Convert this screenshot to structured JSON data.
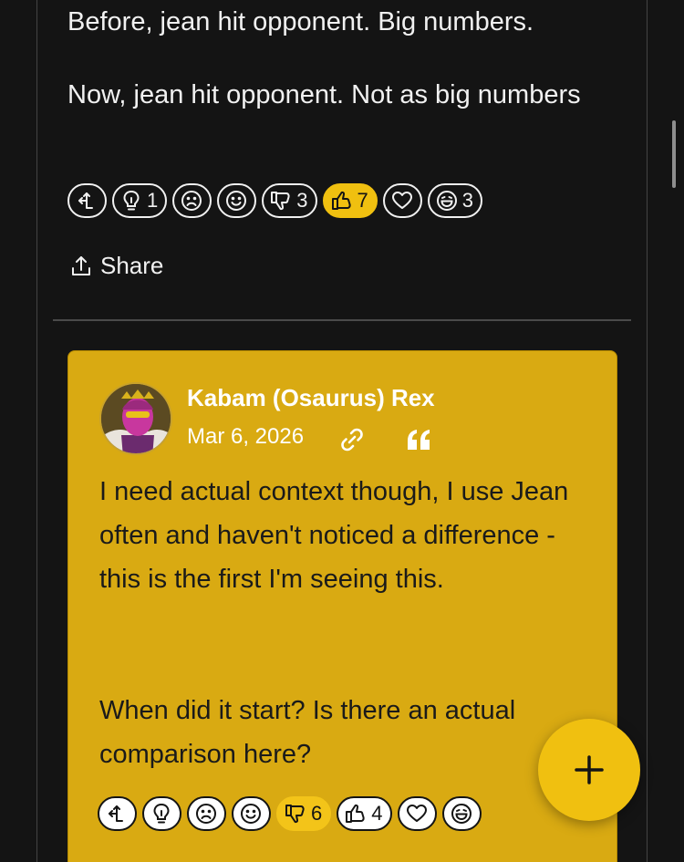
{
  "post": {
    "paragraph_1": "Before, jean hit opponent. Big numbers.",
    "paragraph_2": "Now, jean hit opponent. Not as big numbers",
    "reactions": [
      {
        "icon": "insightful-icon",
        "count": ""
      },
      {
        "icon": "lightbulb-icon",
        "count": "1"
      },
      {
        "icon": "sad-icon",
        "count": ""
      },
      {
        "icon": "smile-icon",
        "count": ""
      },
      {
        "icon": "thumbs-down-icon",
        "count": "3"
      },
      {
        "icon": "thumbs-up-icon",
        "count": "7"
      },
      {
        "icon": "heart-icon",
        "count": ""
      },
      {
        "icon": "laugh-icon",
        "count": "3"
      }
    ],
    "share_label": "Share"
  },
  "reply": {
    "author": "Kabam (Osaurus) Rex",
    "date": "Mar 6, 2026",
    "paragraph_1": "I need actual context though, I use Jean often and haven't noticed a difference - this is the first I'm seeing this.",
    "paragraph_2": "When did it start? Is there an actual comparison here?",
    "reactions": [
      {
        "icon": "insightful-icon",
        "count": ""
      },
      {
        "icon": "lightbulb-icon",
        "count": ""
      },
      {
        "icon": "sad-icon",
        "count": ""
      },
      {
        "icon": "smile-icon",
        "count": ""
      },
      {
        "icon": "thumbs-down-icon",
        "count": "6"
      },
      {
        "icon": "thumbs-up-icon",
        "count": "4"
      },
      {
        "icon": "heart-icon",
        "count": ""
      },
      {
        "icon": "laugh-icon",
        "count": ""
      }
    ]
  },
  "colors": {
    "background": "#141414",
    "accent": "#f0c010",
    "card": "#d9aa12",
    "text": "#f1f1f1"
  }
}
